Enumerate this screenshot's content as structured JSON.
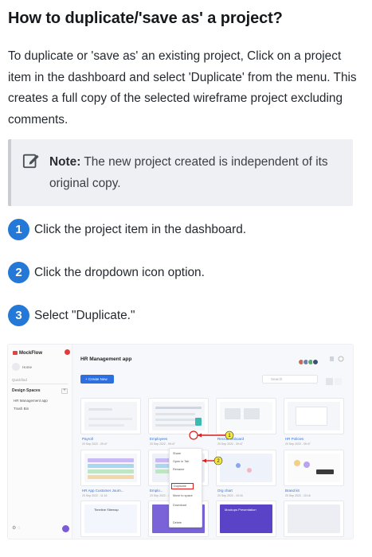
{
  "heading": "How to duplicate/'save as' a project?",
  "intro": "To duplicate or 'save as' an existing project, Click on a project item in the dashboard and select 'Duplicate' from the menu. This creates a full copy of the selected wireframe project excluding comments.",
  "note": {
    "icon": "edit-note-icon",
    "label": "Note:",
    "text": " The new project created is independent of its original copy."
  },
  "steps": [
    {
      "number": "1",
      "text": "Click the project item in the dashboard."
    },
    {
      "number": "2",
      "text": "Click the dropdown icon option."
    },
    {
      "number": "3",
      "text": "Select \"Duplicate.\""
    }
  ],
  "colors": {
    "step_badge": "#2478d8",
    "note_bg": "#eef0f3",
    "note_border": "#c9ccd1",
    "callout_red": "#e01b1b",
    "callout_yellow": "#f6e83a"
  },
  "screenshot": {
    "sidebar": {
      "logo": "MockFlow",
      "home": "Home",
      "search": "Quickfind",
      "section": "Design Spaces",
      "add": "+",
      "items": [
        "HR Management app",
        "Trash Bin"
      ]
    },
    "main": {
      "title": "HR Management app",
      "create_button": "+ Create New",
      "search_placeholder": "Search",
      "projects": [
        {
          "name": "Payroll",
          "date": "20 Sep 2022 - 09:47"
        },
        {
          "name": "Employees",
          "date": "20 Sep 2022 - 09:47"
        },
        {
          "name": "Recruit Onboard",
          "date": "20 Sep 2022 - 09:47"
        },
        {
          "name": "HR Policies",
          "date": "20 Sep 2022 - 09:47"
        },
        {
          "name": "HR App Customer Journ...",
          "date": "20 Sep 2022 - 11:16"
        },
        {
          "name": "Emplo...",
          "date": "20 Sep 2022 - 11:16"
        },
        {
          "name": "Org chart",
          "date": "20 Sep 2022 - 10:16"
        },
        {
          "name": "Brand kit",
          "date": "20 Sep 2022 - 10:16"
        }
      ],
      "bottom_cards": [
        "Timeline Sitemap",
        "",
        "Mockups Presentation",
        ""
      ],
      "menu_items": [
        "Share",
        "Open in Tab",
        "Duplicate",
        "Rename",
        "Move to space",
        "Download",
        "Delete"
      ],
      "callouts": [
        "1",
        "2"
      ]
    }
  }
}
